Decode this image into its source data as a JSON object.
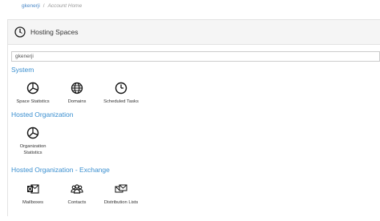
{
  "breadcrumb": {
    "user": "gkenerji",
    "separator": "/",
    "current": "Account Home"
  },
  "header": {
    "title": "Hosting Spaces",
    "icon": "gauge-icon"
  },
  "space_selector": {
    "value": "gkenerji"
  },
  "sections": [
    {
      "title": "System",
      "items": [
        {
          "label": "Space Statistics",
          "icon": "pie-chart-icon"
        },
        {
          "label": "Domains",
          "icon": "globe-icon"
        },
        {
          "label": "Scheduled Tasks",
          "icon": "clock-icon"
        }
      ]
    },
    {
      "title": "Hosted Organization",
      "items": [
        {
          "label": "Organization\nStatistics",
          "icon": "pie-chart-icon"
        }
      ]
    },
    {
      "title": "Hosted Organization - Exchange",
      "items": [
        {
          "label": "Mailboxes",
          "icon": "outlook-icon"
        },
        {
          "label": "Contacts",
          "icon": "users-icon"
        },
        {
          "label": "Distribution Lists",
          "icon": "envelopes-icon"
        }
      ]
    }
  ],
  "colors": {
    "link": "#4a88c7",
    "section_title": "#3a8fd0",
    "header_bg": "#f5f5f5"
  }
}
